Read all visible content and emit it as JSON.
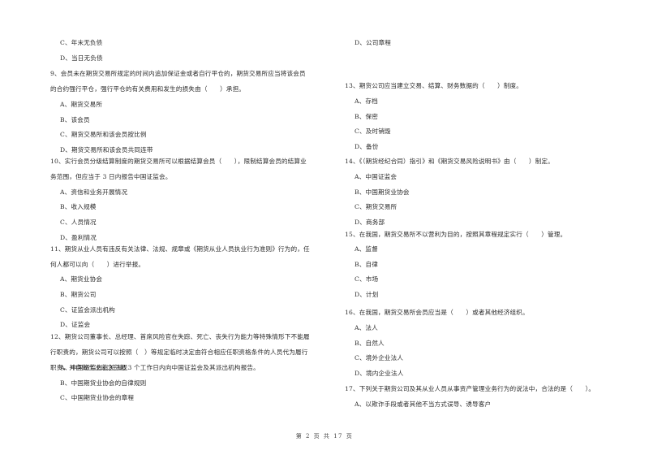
{
  "left_column": [
    {
      "type": "option",
      "text": "C、年末无负债"
    },
    {
      "type": "option",
      "text": "D、当日无负债"
    },
    {
      "type": "question",
      "number": "9",
      "lines": [
        "9、会员未在期货交易所规定的时间内追加保证金或者自行平仓的，期货交易所应当将该会员",
        "的合约强行平仓，强行平仓的有关费用和发生的损失由（　　）承担。"
      ]
    },
    {
      "type": "option",
      "text": "A、期货交易所"
    },
    {
      "type": "option",
      "text": "B、该会员"
    },
    {
      "type": "option",
      "text": "C、期货交易所和该会员按比例"
    },
    {
      "type": "option",
      "text": "D、期货交易所和该会员共同连带"
    },
    {
      "type": "question",
      "number": "10",
      "lines": [
        "10、实行会员分级结算制度的期货交易所可以根据结算会员（　　），限制结算会员的结算业",
        "务范围，但应当于 3 日内报告中国证监会。"
      ]
    },
    {
      "type": "option",
      "text": "A、资信和业务开展情况"
    },
    {
      "type": "option",
      "text": "B、收入规模"
    },
    {
      "type": "option",
      "text": "C、人员情况"
    },
    {
      "type": "option",
      "text": "D、盈利情况"
    },
    {
      "type": "question",
      "number": "11",
      "lines": [
        "11、期货从业人员有违反有关法律、法规、规章或《期货从业人员执业行为准则》行为的，任",
        "何人都可以向（　　）进行举报。"
      ]
    },
    {
      "type": "option",
      "text": "A、期货业协会"
    },
    {
      "type": "option",
      "text": "B、期货公司"
    },
    {
      "type": "option",
      "text": "C、证监会派出机构"
    },
    {
      "type": "option",
      "text": "D、证监会"
    },
    {
      "type": "question",
      "number": "12",
      "lines": [
        "12、期货公司董事长、总经理、首席风险官在失踪、死亡、丧失行为能力等特殊情形下不能履",
        "行职责的，期货公司可以按照（　）等规定临时决定由符合相应任职资格条件的人员代为履行",
        "职责，并自做出决定之日起 3 个工作日内向中国证监会及其派出机构报告。"
      ]
    },
    {
      "type": "option",
      "text": "A、中国证监会有关法规"
    },
    {
      "type": "option",
      "text": "B、中国期货业协会的自律规则"
    },
    {
      "type": "option",
      "text": "C、中国期货业协会的章程"
    }
  ],
  "right_column": [
    {
      "type": "option",
      "text": "D、公司章程"
    },
    {
      "type": "question",
      "number": "13",
      "lines": [
        "13、期货公司应当建立交易、结算、财务数据的（　　）制度。"
      ]
    },
    {
      "type": "option",
      "text": "A、存档"
    },
    {
      "type": "option",
      "text": "B、保密"
    },
    {
      "type": "option",
      "text": "C、及时销毁"
    },
    {
      "type": "option",
      "text": "D、备份"
    },
    {
      "type": "question",
      "number": "14",
      "lines": [
        "14、《（期货经纪合同）指引》和《期货交易风险说明书》由（　　）制定。"
      ]
    },
    {
      "type": "option",
      "text": "A、中国证监会"
    },
    {
      "type": "option",
      "text": "B、中国期货业协会"
    },
    {
      "type": "option",
      "text": "C、期货交易所"
    },
    {
      "type": "option",
      "text": "D、商务部"
    },
    {
      "type": "question",
      "number": "15",
      "lines": [
        "15、在我国，期货交易所不以营利为目的，按照其章程规定实行（　　）管理。"
      ]
    },
    {
      "type": "option",
      "text": "A、监督"
    },
    {
      "type": "option",
      "text": "B、自律"
    },
    {
      "type": "option",
      "text": "C、市场"
    },
    {
      "type": "option",
      "text": "D、计划"
    },
    {
      "type": "question",
      "number": "16",
      "lines": [
        "16、在我国，期货交易所会员应当是（　　）或者其他经济组织。"
      ]
    },
    {
      "type": "option",
      "text": "A、法人"
    },
    {
      "type": "option",
      "text": "B、自然人"
    },
    {
      "type": "option",
      "text": "C、境外企业法人"
    },
    {
      "type": "option",
      "text": "D、境内企业法人"
    },
    {
      "type": "question",
      "number": "17",
      "lines": [
        "17、下列关于期货公司及其从业人员从事资产管理业务行为的说法中，合法的是（　　）。"
      ]
    },
    {
      "type": "option",
      "text": "A、以欺诈手段或者其他不当方式误导、诱导客户"
    }
  ],
  "footer": {
    "page_label": "第 2 页 共 17 页"
  }
}
